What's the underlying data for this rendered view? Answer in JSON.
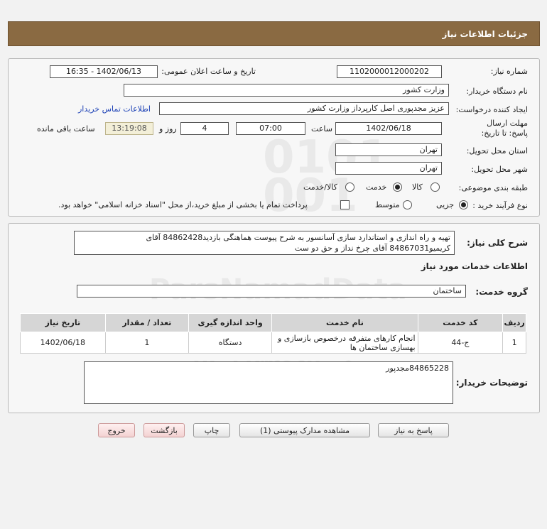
{
  "header": {
    "title": "جزئیات اطلاعات نیاز"
  },
  "form": {
    "need_number_label": "شماره نیاز:",
    "need_number": "1102000012000202",
    "announce_label": "تاریخ و ساعت اعلان عمومی:",
    "announce_value": "1402/06/13 - 16:35",
    "buyer_org_label": "نام دستگاه خریدار:",
    "buyer_org": "وزارت کشور",
    "requester_label": "ایجاد کننده درخواست:",
    "requester": "عزیز مجدپوری اصل کارپرداز وزارت کشور",
    "contact_link": "اطلاعات تماس خریدار",
    "deadline_label": "مهلت ارسال پاسخ: تا تاریخ:",
    "deadline_date": "1402/06/18",
    "time_label": "ساعت",
    "deadline_time": "07:00",
    "days_value": "4",
    "days_label": "روز و",
    "remaining_time": "13:19:08",
    "remaining_label": "ساعت باقی مانده",
    "province_label": "استان محل تحویل:",
    "province": "تهران",
    "city_label": "شهر محل تحویل:",
    "city": "تهران",
    "category_label": "طبقه بندی موضوعی:",
    "category_options": [
      "کالا",
      "خدمت",
      "کالا/خدمت"
    ],
    "category_selected": "خدمت",
    "process_label": "نوع فرآیند خرید :",
    "process_options": [
      "جزیی",
      "متوسط"
    ],
    "process_selected": "جزیی",
    "treasury_note": "پرداخت تمام یا بخشی از مبلغ خرید،از محل \"اسناد خزانه اسلامی\" خواهد بود.",
    "treasury_checked": false
  },
  "details": {
    "desc_label": "شرح کلی نیاز:",
    "desc_line1": "تهیه و راه اندازی و استاندارد سازی آسانسور به شرح پیوست هماهنگی بازدید84862428 آقای",
    "desc_line2": "کریمیو84867031 آقای چرخ نداز و حق دو ست",
    "services_title": "اطلاعات خدمات مورد نیاز",
    "service_group_label": "گروه خدمت:",
    "service_group": "ساختمان",
    "table_headers": [
      "ردیف",
      "کد خدمت",
      "نام خدمت",
      "واحد اندازه گیری",
      "تعداد / مقدار",
      "تاریخ نیاز"
    ],
    "rows": [
      {
        "row": "1",
        "code": "ج-44",
        "name": "انجام کارهای متفرقه درخصوص بازسازی و بهسازی ساختمان ها",
        "unit": "دستگاه",
        "qty": "1",
        "date": "1402/06/18"
      }
    ],
    "buyer_notes_label": "توضیحات خریدار:",
    "buyer_notes": "84865228مجدپور"
  },
  "buttons": {
    "reply": "پاسخ به نیاز",
    "view_docs": "مشاهده مدارک پیوستی (1)",
    "print": "چاپ",
    "back": "بازگشت",
    "exit": "خروج"
  },
  "colors": {
    "header_bg": "#8a6a42",
    "link": "#1a3fb5",
    "remaining_bg": "#f3efd8",
    "pink_button": "#f3d2d2"
  }
}
